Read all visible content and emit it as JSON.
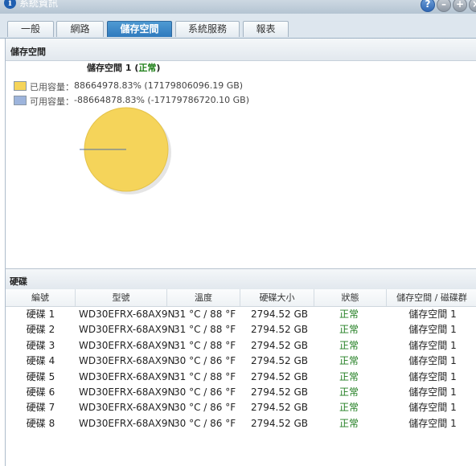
{
  "window": {
    "title": "系統資訊",
    "help_glyph": "i"
  },
  "tabs": [
    {
      "label": "一般",
      "active": false
    },
    {
      "label": "網路",
      "active": false
    },
    {
      "label": "儲存空間",
      "active": true
    },
    {
      "label": "系統服務",
      "active": false
    },
    {
      "label": "報表",
      "active": false
    }
  ],
  "storage": {
    "section_title": "儲存空間",
    "volume_name": "儲存空間 1 (",
    "volume_status": "正常",
    "volume_close": ")",
    "used_label": "已用容量：",
    "used_value": "88664978.83% (17179806096.19 GB)",
    "free_label": "可用容量：",
    "free_value": "-88664878.83% (-17179786720.10 GB)",
    "used_color": "#f5d45a",
    "free_color": "#9db4dc"
  },
  "chart_data": {
    "type": "pie",
    "categories": [
      "已用容量",
      "可用容量"
    ],
    "values": [
      88664978.83,
      -88664878.83
    ],
    "colors": [
      "#f5d45a",
      "#9db4dc"
    ]
  },
  "disks": {
    "section_title": "硬碟",
    "columns": [
      "編號",
      "型號",
      "溫度",
      "硬碟大小",
      "狀態",
      "儲存空間 / 磁碟群"
    ],
    "rows": [
      {
        "id": "硬碟 1",
        "model": "WD30EFRX-68AX9N",
        "temp": "31 °C / 88 °F",
        "size": "2794.52 GB",
        "status": "正常",
        "volume": "儲存空間 1"
      },
      {
        "id": "硬碟 2",
        "model": "WD30EFRX-68AX9N",
        "temp": "31 °C / 88 °F",
        "size": "2794.52 GB",
        "status": "正常",
        "volume": "儲存空間 1"
      },
      {
        "id": "硬碟 3",
        "model": "WD30EFRX-68AX9N",
        "temp": "31 °C / 88 °F",
        "size": "2794.52 GB",
        "status": "正常",
        "volume": "儲存空間 1"
      },
      {
        "id": "硬碟 4",
        "model": "WD30EFRX-68AX9N",
        "temp": "30 °C / 86 °F",
        "size": "2794.52 GB",
        "status": "正常",
        "volume": "儲存空間 1"
      },
      {
        "id": "硬碟 5",
        "model": "WD30EFRX-68AX9N",
        "temp": "31 °C / 88 °F",
        "size": "2794.52 GB",
        "status": "正常",
        "volume": "儲存空間 1"
      },
      {
        "id": "硬碟 6",
        "model": "WD30EFRX-68AX9N",
        "temp": "30 °C / 86 °F",
        "size": "2794.52 GB",
        "status": "正常",
        "volume": "儲存空間 1"
      },
      {
        "id": "硬碟 7",
        "model": "WD30EFRX-68AX9N",
        "temp": "30 °C / 86 °F",
        "size": "2794.52 GB",
        "status": "正常",
        "volume": "儲存空間 1"
      },
      {
        "id": "硬碟 8",
        "model": "WD30EFRX-68AX9N",
        "temp": "30 °C / 86 °F",
        "size": "2794.52 GB",
        "status": "正常",
        "volume": "儲存空間 1"
      }
    ]
  }
}
